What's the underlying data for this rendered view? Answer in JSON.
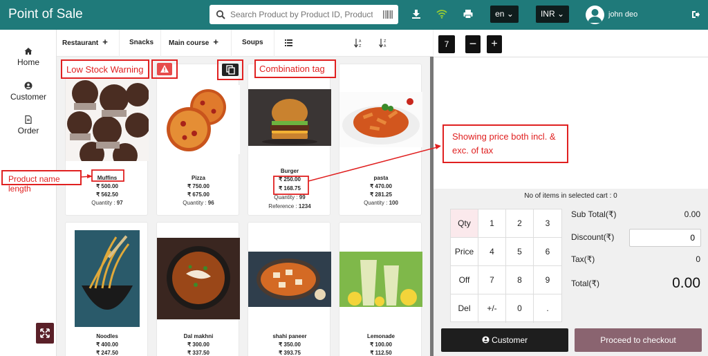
{
  "header": {
    "title": "Point of Sale",
    "search_placeholder": "Search Product by Product ID, Product na",
    "language": "en",
    "currency": "INR",
    "user_name": "john deo",
    "icons": [
      "search-icon",
      "barcode-icon",
      "download-icon",
      "wifi-icon",
      "printer-icon",
      "user-avatar-icon",
      "logout-icon"
    ]
  },
  "nav": {
    "items": [
      {
        "label": "Home",
        "icon": "home-icon"
      },
      {
        "label": "Customer",
        "icon": "user-circle-icon"
      },
      {
        "label": "Order",
        "icon": "document-icon"
      }
    ]
  },
  "categories": [
    {
      "label": "Restaurant",
      "has_plus": true
    },
    {
      "label": "Snacks",
      "has_plus": false
    },
    {
      "label": "Main course",
      "has_plus": true
    },
    {
      "label": "Soups",
      "has_plus": false
    }
  ],
  "products": [
    {
      "name": "Muffins",
      "price_incl": "₹ 500.00",
      "price_excl": "₹ 562.50",
      "quantity_label": "Quantity :",
      "quantity": "97"
    },
    {
      "name": "Pizza",
      "price_incl": "₹ 750.00",
      "price_excl": "₹ 675.00",
      "quantity_label": "Quantity :",
      "quantity": "96"
    },
    {
      "name": "Burger",
      "price_incl": "₹ 250.00",
      "price_excl": "₹ 168.75",
      "quantity_label": "Quantity :",
      "quantity": "99",
      "reference_label": "Reference :",
      "reference": "1234"
    },
    {
      "name": "pasta",
      "price_incl": "₹ 470.00",
      "price_excl": "₹ 281.25",
      "quantity_label": "Quantity :",
      "quantity": "100"
    },
    {
      "name": "Noodles",
      "price_incl": "₹ 400.00",
      "price_excl": "₹ 247.50"
    },
    {
      "name": "Dal makhni",
      "price_incl": "₹ 300.00",
      "price_excl": "₹ 337.50"
    },
    {
      "name": "shahi paneer",
      "price_incl": "₹ 350.00",
      "price_excl": "₹ 393.75"
    },
    {
      "name": "Lemonade",
      "price_incl": "₹ 100.00",
      "price_excl": "₹ 112.50"
    }
  ],
  "cart": {
    "quantity": "7",
    "items_label": "No of items in selected cart : 0"
  },
  "keypad": {
    "keys": [
      "Qty",
      "1",
      "2",
      "3",
      "Price",
      "4",
      "5",
      "6",
      "Off",
      "7",
      "8",
      "9",
      "Del",
      "+/-",
      "0",
      "."
    ]
  },
  "summary": {
    "subtotal_label": "Sub Total(₹)",
    "subtotal": "0.00",
    "discount_label": "Discount(₹)",
    "discount": "0",
    "tax_label": "Tax(₹)",
    "tax": "0",
    "total_label": "Total(₹)",
    "total": "0.00"
  },
  "buttons": {
    "customer": "Customer",
    "checkout": "Proceed to checkout"
  },
  "annotations": {
    "low_stock": "Low Stock Warning",
    "combination": "Combination tag",
    "price_tax_line1": "Showing price both incl. &",
    "price_tax_line2": "exc. of tax",
    "name_length": "Product name length"
  },
  "colors": {
    "header": "#1f7a7a",
    "warning": "#e74c4c",
    "checkout": "#8a6470",
    "annotation": "#e02020"
  }
}
